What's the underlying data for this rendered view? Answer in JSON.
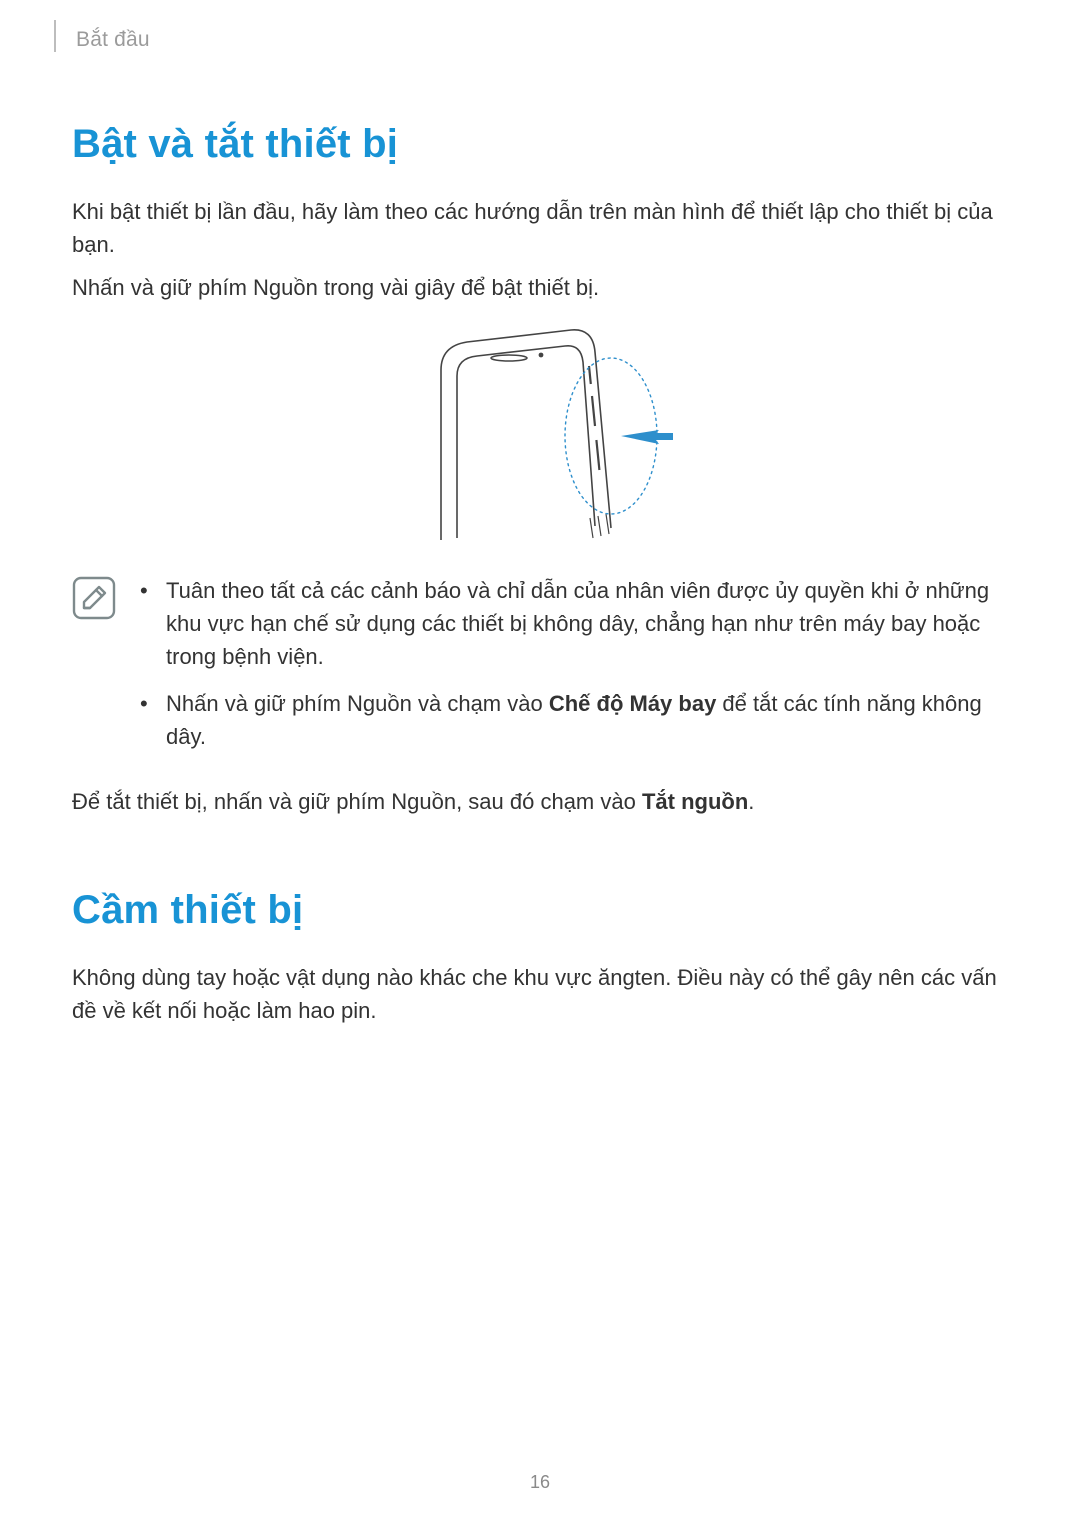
{
  "header": {
    "breadcrumb": "Bắt đầu"
  },
  "section1": {
    "title": "Bật và tắt thiết bị",
    "para1": "Khi bật thiết bị lần đầu, hãy làm theo các hướng dẫn trên màn hình để thiết lập cho thiết bị của bạn.",
    "para2": "Nhấn và giữ phím Nguồn trong vài giây để bật thiết bị.",
    "note1_prefix": "Tuân theo tất cả các cảnh báo và chỉ dẫn của nhân viên được ủy quyền khi ở những khu vực hạn chế sử dụng các thiết bị không dây, chẳng hạn như trên máy bay hoặc trong bệnh viện.",
    "note2_prefix": "Nhấn và giữ phím Nguồn và chạm vào ",
    "note2_bold": "Chế độ Máy bay",
    "note2_suffix": " để tắt các tính năng không dây.",
    "para3_prefix": "Để tắt thiết bị, nhấn và giữ phím Nguồn, sau đó chạm vào ",
    "para3_bold": "Tắt nguồn",
    "para3_suffix": "."
  },
  "section2": {
    "title": "Cầm thiết bị",
    "para1": "Không dùng tay hoặc vật dụng nào khác che khu vực ăngten. Điều này có thể gây nên các vấn đề về kết nối hoặc làm hao pin."
  },
  "page_number": "16",
  "icons": {
    "note_icon_name": "note-pencil-icon",
    "phone_illustration_name": "phone-power-button-illustration"
  },
  "colors": {
    "heading": "#1893d5",
    "text": "#333333",
    "muted": "#9b9b9b",
    "note_border": "#7e8a8c",
    "note_fill": "#ffffff",
    "arrow": "#2e8fcc"
  }
}
